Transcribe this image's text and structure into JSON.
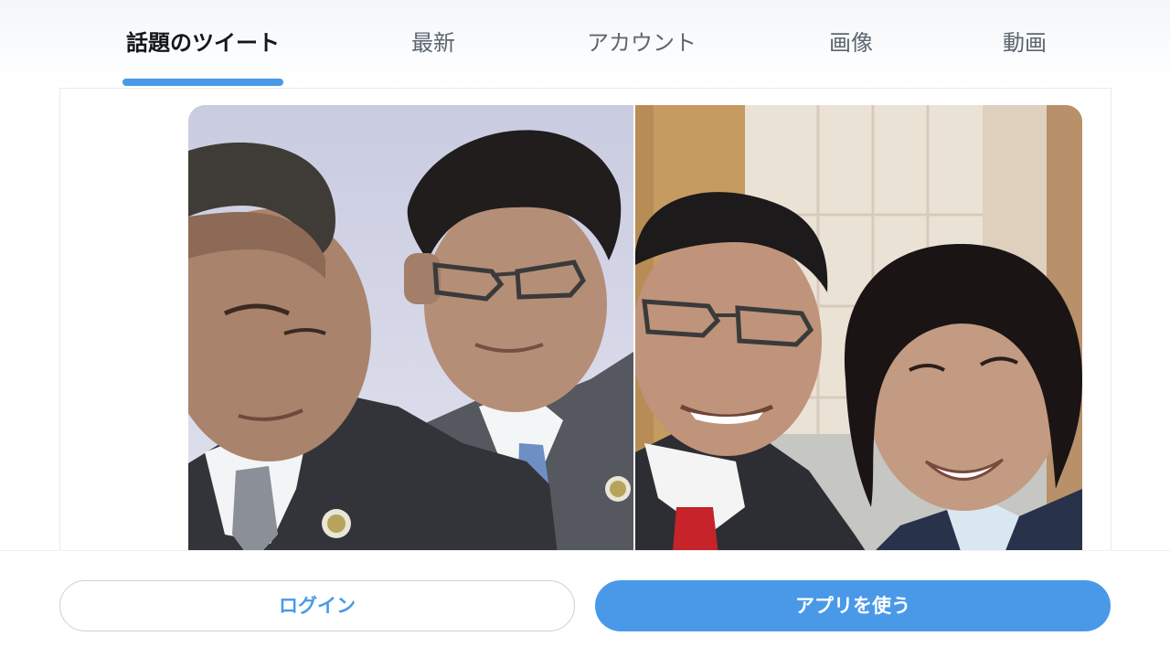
{
  "tabs": [
    {
      "label": "話題のツイート",
      "active": true
    },
    {
      "label": "最新",
      "active": false
    },
    {
      "label": "アカウント",
      "active": false
    },
    {
      "label": "画像",
      "active": false
    },
    {
      "label": "動画",
      "active": false
    }
  ],
  "tweet": {
    "media": [
      {
        "kind": "photo",
        "subject": "two-men-in-suits"
      },
      {
        "kind": "photo",
        "subject": "selfie-man-and-woman"
      }
    ]
  },
  "bottom_bar": {
    "login_label": "ログイン",
    "app_label": "アプリを使う"
  },
  "colors": {
    "accent": "#4a99e9",
    "active_tab_text": "#14171a",
    "inactive_tab_text": "#5b6670",
    "border": "#e6ecf0"
  }
}
